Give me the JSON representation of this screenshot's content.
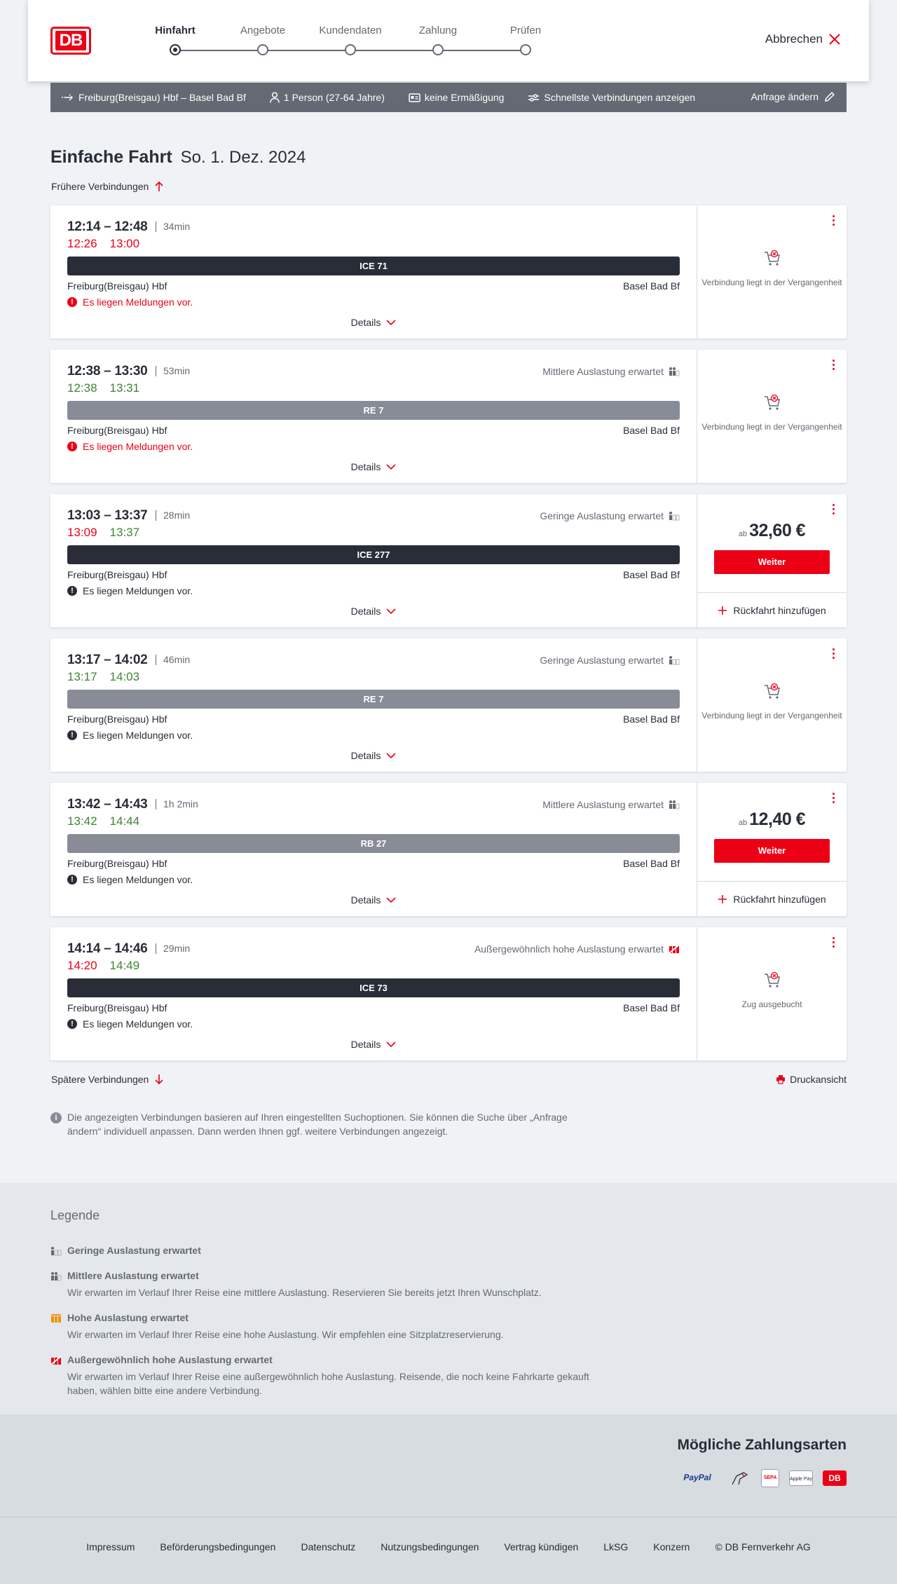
{
  "header": {
    "logo_text": "DB",
    "steps": [
      {
        "label": "Hinfahrt",
        "active": true
      },
      {
        "label": "Angebote",
        "active": false
      },
      {
        "label": "Kundendaten",
        "active": false
      },
      {
        "label": "Zahlung",
        "active": false
      },
      {
        "label": "Prüfen",
        "active": false
      }
    ],
    "cancel_label": "Abbrechen"
  },
  "request": {
    "route": "Freiburg(Breisgau) Hbf – Basel Bad Bf",
    "travellers": "1 Person (27-64 Jahre)",
    "discount": "keine Ermäßigung",
    "filter": "Schnellste Verbindungen anzeigen",
    "change_label": "Anfrage ändern"
  },
  "page": {
    "title": "Einfache Fahrt",
    "date": "So. 1. Dez. 2024",
    "earlier_label": "Frühere Verbindungen",
    "later_label": "Spätere Verbindungen",
    "print_label": "Druckansicht",
    "info_text": "Die angezeigten Verbindungen basieren auf Ihren eingestellten Suchoptionen. Sie können die Suche über „Anfrage ändern“ individuell anpassen. Dann werden Ihnen ggf. weitere Verbindungen angezeigt."
  },
  "connections": [
    {
      "times": "12:14 – 12:48",
      "duration": "34min",
      "rt_dep": "12:26",
      "rt_arr": "13:00",
      "rt_dep_color": "red",
      "rt_arr_color": "red",
      "load": "",
      "load_level": "",
      "train": "ICE 71",
      "train_style": "dark",
      "from": "Freiburg(Breisgau) Hbf",
      "to": "Basel Bad Bf",
      "message": "Es liegen Meldungen vor.",
      "message_color": "red",
      "details": "Details",
      "status": "Verbindung liegt in der Vergangenheit",
      "price": "",
      "price_prefix": "",
      "button": "",
      "return_label": ""
    },
    {
      "times": "12:38 – 13:30",
      "duration": "53min",
      "rt_dep": "12:38",
      "rt_arr": "13:31",
      "rt_dep_color": "green",
      "rt_arr_color": "green",
      "load": "Mittlere Auslastung erwartet",
      "load_level": "medium",
      "train": "RE 7",
      "train_style": "grey",
      "from": "Freiburg(Breisgau) Hbf",
      "to": "Basel Bad Bf",
      "message": "Es liegen Meldungen vor.",
      "message_color": "red",
      "details": "Details",
      "status": "Verbindung liegt in der Vergangenheit",
      "price": "",
      "price_prefix": "",
      "button": "",
      "return_label": ""
    },
    {
      "times": "13:03 – 13:37",
      "duration": "28min",
      "rt_dep": "13:09",
      "rt_arr": "13:37",
      "rt_dep_color": "red",
      "rt_arr_color": "green",
      "load": "Geringe Auslastung erwartet",
      "load_level": "low",
      "train": "ICE 277",
      "train_style": "dark",
      "from": "Freiburg(Breisgau) Hbf",
      "to": "Basel Bad Bf",
      "message": "Es liegen Meldungen vor.",
      "message_color": "black",
      "details": "Details",
      "status": "",
      "price": "32,60 €",
      "price_prefix": "ab",
      "button": "Weiter",
      "return_label": "Rückfahrt hinzufügen"
    },
    {
      "times": "13:17 – 14:02",
      "duration": "46min",
      "rt_dep": "13:17",
      "rt_arr": "14:03",
      "rt_dep_color": "green",
      "rt_arr_color": "green",
      "load": "Geringe Auslastung erwartet",
      "load_level": "low",
      "train": "RE 7",
      "train_style": "grey",
      "from": "Freiburg(Breisgau) Hbf",
      "to": "Basel Bad Bf",
      "message": "Es liegen Meldungen vor.",
      "message_color": "black",
      "details": "Details",
      "status": "Verbindung liegt in der Vergangenheit",
      "price": "",
      "price_prefix": "",
      "button": "",
      "return_label": ""
    },
    {
      "times": "13:42 – 14:43",
      "duration": "1h 2min",
      "rt_dep": "13:42",
      "rt_arr": "14:44",
      "rt_dep_color": "green",
      "rt_arr_color": "green",
      "load": "Mittlere Auslastung erwartet",
      "load_level": "medium",
      "train": "RB 27",
      "train_style": "grey",
      "from": "Freiburg(Breisgau) Hbf",
      "to": "Basel Bad Bf",
      "message": "Es liegen Meldungen vor.",
      "message_color": "black",
      "details": "Details",
      "status": "",
      "price": "12,40 €",
      "price_prefix": "ab",
      "button": "Weiter",
      "return_label": "Rückfahrt hinzufügen"
    },
    {
      "times": "14:14 – 14:46",
      "duration": "29min",
      "rt_dep": "14:20",
      "rt_arr": "14:49",
      "rt_dep_color": "red",
      "rt_arr_color": "green",
      "load": "Außergewöhnlich hohe Auslastung erwartet",
      "load_level": "extreme",
      "train": "ICE 73",
      "train_style": "dark",
      "from": "Freiburg(Breisgau) Hbf",
      "to": "Basel Bad Bf",
      "message": "Es liegen Meldungen vor.",
      "message_color": "black",
      "details": "Details",
      "status": "Zug ausgebucht",
      "price": "",
      "price_prefix": "",
      "button": "",
      "return_label": ""
    }
  ],
  "legend": {
    "title": "Legende",
    "items": [
      {
        "title": "Geringe Auslastung erwartet",
        "desc": "",
        "level": "low"
      },
      {
        "title": "Mittlere Auslastung erwartet",
        "desc": "Wir erwarten im Verlauf Ihrer Reise eine mittlere Auslastung. Reservieren Sie bereits jetzt Ihren Wunschplatz.",
        "level": "medium"
      },
      {
        "title": "Hohe Auslastung erwartet",
        "desc": "Wir erwarten im Verlauf Ihrer Reise eine hohe Auslastung. Wir empfehlen eine Sitzplatzreservierung.",
        "level": "high"
      },
      {
        "title": "Außergewöhnlich hohe Auslastung erwartet",
        "desc": "Wir erwarten im Verlauf Ihrer Reise eine außergewöhnlich hohe Auslastung. Reisende, die noch keine Fahrkarte gekauft haben, wählen bitte eine andere Verbindung.",
        "level": "extreme"
      }
    ]
  },
  "payment": {
    "title": "Mögliche Zahlungsarten",
    "methods": [
      "PayPal",
      "Kreditkarte",
      "SEPA",
      "Apple Pay",
      "DB"
    ]
  },
  "footer": {
    "links": [
      "Impressum",
      "Beförderungsbedingungen",
      "Datenschutz",
      "Nutzungsbedingungen",
      "Vertrag kündigen",
      "LkSG",
      "Konzern",
      "© DB Fernverkehr AG"
    ]
  },
  "colors": {
    "accent": "#ec0016",
    "on_time": "#408335",
    "text": "#282d37",
    "muted": "#646973",
    "load_high": "#f39200"
  }
}
